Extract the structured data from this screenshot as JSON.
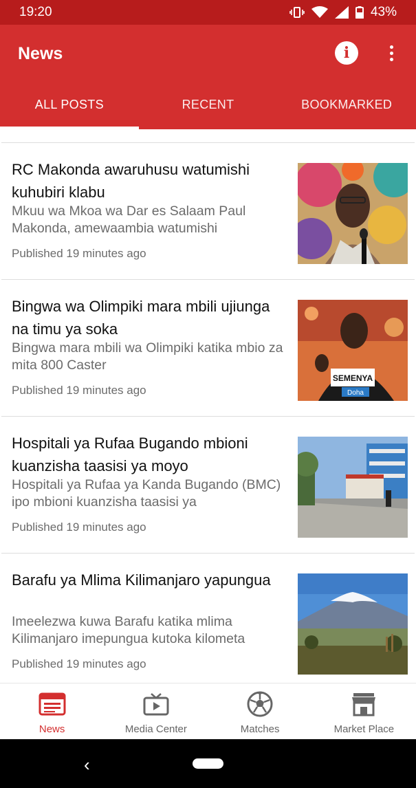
{
  "status_bar": {
    "time": "19:20",
    "battery": "43%"
  },
  "app_bar": {
    "title": "News",
    "info_icon": "info-icon",
    "more_icon": "more-vert-icon",
    "accent_color": "#d32f2f",
    "status_color": "#b71c1c"
  },
  "tabs": [
    {
      "label": "ALL POSTS",
      "active": true
    },
    {
      "label": "RECENT",
      "active": false
    },
    {
      "label": "BOOKMARKED",
      "active": false
    }
  ],
  "posts": [
    {
      "title": "RC Makonda awaruhusu watumishi kuhubiri klabu",
      "summary": "Mkuu wa Mkoa wa Dar es Salaam Paul Makonda, amewaambia watumishi",
      "meta": "Published 19 minutes ago"
    },
    {
      "title": "Bingwa wa Olimpiki mara mbili ujiunga na timu ya soka",
      "summary": "Bingwa mara mbili wa Olimpiki katika mbio za mita 800 Caster",
      "meta": "Published 19 minutes ago"
    },
    {
      "title": "Hospitali ya Rufaa Bugando mbioni kuanzisha taasisi ya moyo",
      "summary": "Hospitali ya Rufaa ya Kanda Bugando (BMC) ipo mbioni kuanzisha taasisi ya",
      "meta": "Published 19 minutes ago"
    },
    {
      "title": "Barafu ya Mlima Kilimanjaro yapungua",
      "summary": "Imeelezwa kuwa Barafu katika mlima Kilimanjaro imepungua kutoka kilometa",
      "meta": "Published 19 minutes ago"
    }
  ],
  "thumb_labels": {
    "post2_bib": "SEMENYA",
    "post2_bib_city": "Doha"
  },
  "bottom_nav": [
    {
      "label": "News",
      "icon": "newspaper-icon",
      "active": true
    },
    {
      "label": "Media Center",
      "icon": "tv-play-icon",
      "active": false
    },
    {
      "label": "Matches",
      "icon": "soccer-ball-icon",
      "active": false
    },
    {
      "label": "Market Place",
      "icon": "storefront-icon",
      "active": false
    }
  ]
}
